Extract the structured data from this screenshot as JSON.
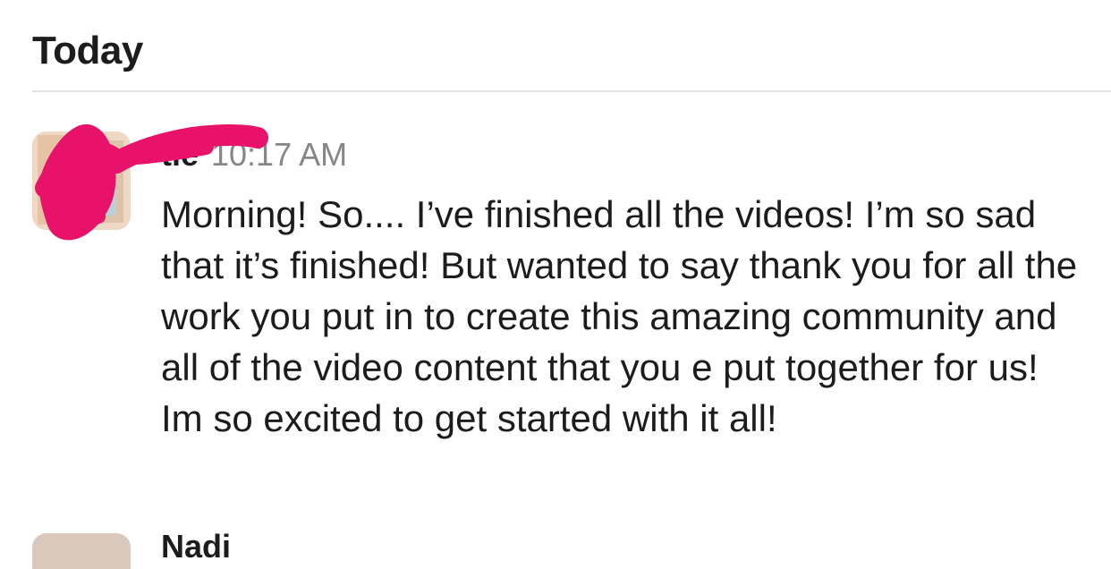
{
  "day_divider": {
    "label": "Today"
  },
  "message": {
    "sender_name": "tie",
    "timestamp": "10:17 AM",
    "text": "Morning! So.... I’ve finished all the videos! I’m so sad that it’s finished! But wanted to say thank you for all the work you put in to create this amazing community and all of the video content that you e put together for us! Im so excited to get started with it all!"
  },
  "next_message": {
    "sender_name": "Nadi"
  },
  "colors": {
    "redaction": "#e8126b",
    "timestamp": "#868686",
    "divider": "#e3e3e3"
  },
  "icons": {
    "avatar": "user-avatar-photo",
    "redaction": "redaction-scribble"
  }
}
